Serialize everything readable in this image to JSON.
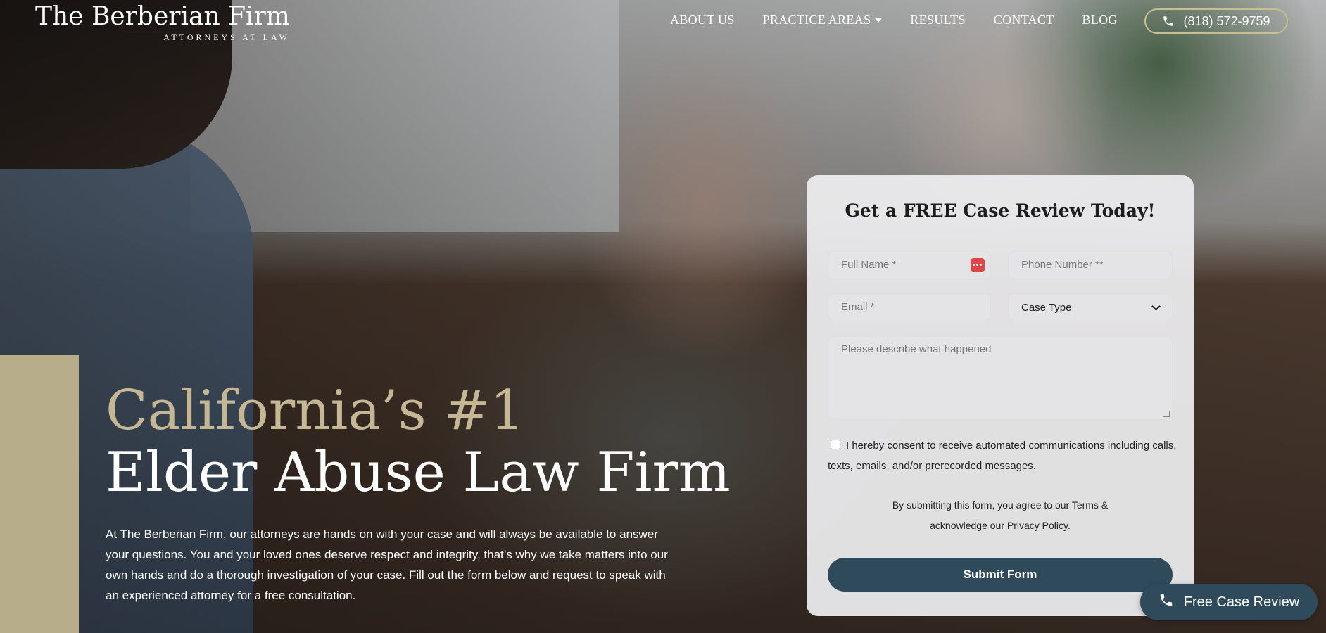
{
  "brand": {
    "name": "The Berberian Firm",
    "tagline": "ATTORNEYS AT LAW"
  },
  "nav": {
    "items": [
      {
        "label": "ABOUT US"
      },
      {
        "label": "PRACTICE AREAS",
        "has_dropdown": true
      },
      {
        "label": "RESULTS"
      },
      {
        "label": "CONTACT"
      },
      {
        "label": "BLOG"
      }
    ],
    "phone": "(818) 572-9759"
  },
  "hero": {
    "title_line1": "California’s #1",
    "title_line2": "Elder Abuse Law Firm",
    "body": "At The Berberian Firm, our attorneys are hands on with your case and will always be available to answer your questions. You and your loved ones deserve respect and integrity, that’s why we take matters into our own hands and do a thorough investigation of your case. Fill out the form below and request to speak with an experienced attorney for a free consultation."
  },
  "form": {
    "title": "Get a FREE Case Review Today!",
    "full_name_placeholder": "Full Name *",
    "phone_placeholder": "Phone Number **",
    "email_placeholder": "Email *",
    "case_type_selected": "Case Type",
    "message_placeholder": "Please describe what happened",
    "consent_text": "I hereby consent to receive automated communications including calls, texts, emails, and/or prerecorded messages.",
    "terms_text": "By submitting this form, you agree to our Terms & acknowledge our Privacy Policy.",
    "submit_label": "Submit Form"
  },
  "floating_cta": {
    "label": "Free Case Review"
  },
  "colors": {
    "gold": "#c5b793",
    "button_dark": "#2f4b5b",
    "accent_red": "#e04848"
  }
}
